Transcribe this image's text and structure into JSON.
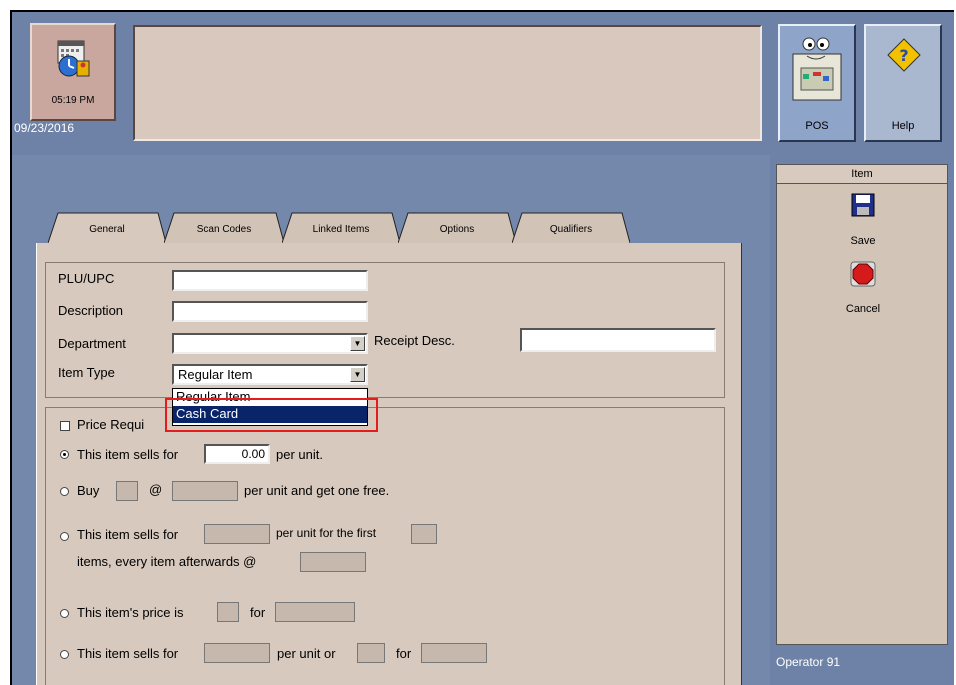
{
  "clock": {
    "time": "05:19 PM",
    "date": "09/23/2016",
    "icon": "calendar-clock-icon"
  },
  "header": {
    "message": ""
  },
  "toolbar": {
    "pos_label": "POS",
    "help_label": "Help",
    "pos_icon": "register-icon",
    "help_icon": "diamond-question-icon"
  },
  "side_panel": {
    "title": "Item",
    "save_label": "Save",
    "cancel_label": "Cancel",
    "save_icon": "floppy-disk-icon",
    "cancel_icon": "stop-sign-icon"
  },
  "status": {
    "operator": "Operator 91"
  },
  "tabs": [
    {
      "label": "General",
      "active": true
    },
    {
      "label": "Scan Codes"
    },
    {
      "label": "Linked Items"
    },
    {
      "label": "Options"
    },
    {
      "label": "Qualifiers"
    }
  ],
  "form": {
    "plu_label": "PLU/UPC",
    "plu_value": "",
    "desc_label": "Description",
    "desc_value": "",
    "dept_label": "Department",
    "dept_value": "",
    "receipt_label": "Receipt Desc.",
    "receipt_value": "",
    "itemtype_label": "Item Type",
    "itemtype_value": "Regular Item",
    "itemtype_options": [
      "Regular Item",
      "Cash Card"
    ],
    "itemtype_highlighted": "Cash Card"
  },
  "pricing": {
    "price_required_label": "Price Requi",
    "sells_for_label": "This item sells for",
    "sells_for_value": "0.00",
    "per_unit": "per unit.",
    "buy_label": "Buy",
    "at_symbol": "@",
    "buy_suffix": "per unit and get one free.",
    "tiered_label": "This item sells for",
    "tiered_mid": "per unit for the first",
    "tiered_line2": "items, every item afterwards @",
    "price_is_label": "This item's price is",
    "for_label": "for",
    "sells_for2_label": "This item sells for",
    "per_unit_or": "per unit or",
    "for_label2": "for"
  },
  "colors": {
    "accent_highlight": "#e41c1c",
    "selection": "#0a246a"
  }
}
